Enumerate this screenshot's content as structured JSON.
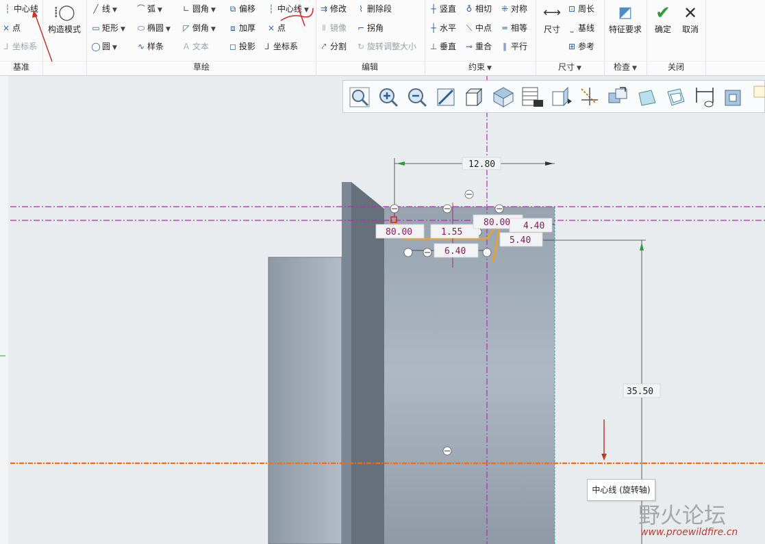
{
  "ribbon": {
    "datum": {
      "title": "基准",
      "centerline": "中心线",
      "point": "点",
      "coord_sys": "坐标系"
    },
    "construct": {
      "label": "构造模式"
    },
    "sketch": {
      "title": "草绘",
      "line": "线",
      "arc": "弧",
      "fillet": "圆角",
      "offset": "偏移",
      "centerline": "中心线",
      "rectangle": "矩形",
      "ellipse": "椭圆",
      "chamfer": "倒角",
      "thicken": "加厚",
      "point": "点",
      "circle": "圆",
      "spline": "样条",
      "text": "文本",
      "project": "投影",
      "coord_sys": "坐标系"
    },
    "edit": {
      "title": "编辑",
      "modify": "修改",
      "delete_seg": "删除段",
      "mirror": "镜像",
      "corner": "拐角",
      "divide": "分割",
      "rotate_resize": "旋转调整大小"
    },
    "constrain": {
      "title": "约束",
      "vertical": "竖直",
      "tangent": "相切",
      "symmetric": "对称",
      "horizontal": "水平",
      "midpoint": "中点",
      "equal": "相等",
      "perpendicular": "垂直",
      "coincident": "重合",
      "parallel": "平行"
    },
    "dimension": {
      "title": "尺寸",
      "dimension": "尺寸",
      "perimeter": "周长",
      "baseline": "基线",
      "reference": "参考"
    },
    "inspect": {
      "title": "检查",
      "feature_req": "特征要求"
    },
    "close": {
      "title": "关闭",
      "ok": "确定",
      "cancel": "取消"
    }
  },
  "sketch_dims": {
    "d_top": "12.80",
    "d_angle_left": "80.00",
    "d_small": "1.55",
    "d_angle_right": "80.00",
    "d_right1": "4.40",
    "d_right2": "5.40",
    "d_bottom": "6.40",
    "d_height": "35.50"
  },
  "tooltip": "中心线 (旋转轴)",
  "watermark": {
    "cn": "野火论坛",
    "en": "www.proewildfire.cn"
  },
  "colors": {
    "accent": "#2a5d9c",
    "centerline": "#c020c0",
    "axis": "#ff6a00",
    "dimension": "#8b1a5a",
    "ok_green": "#2e9a3a"
  }
}
